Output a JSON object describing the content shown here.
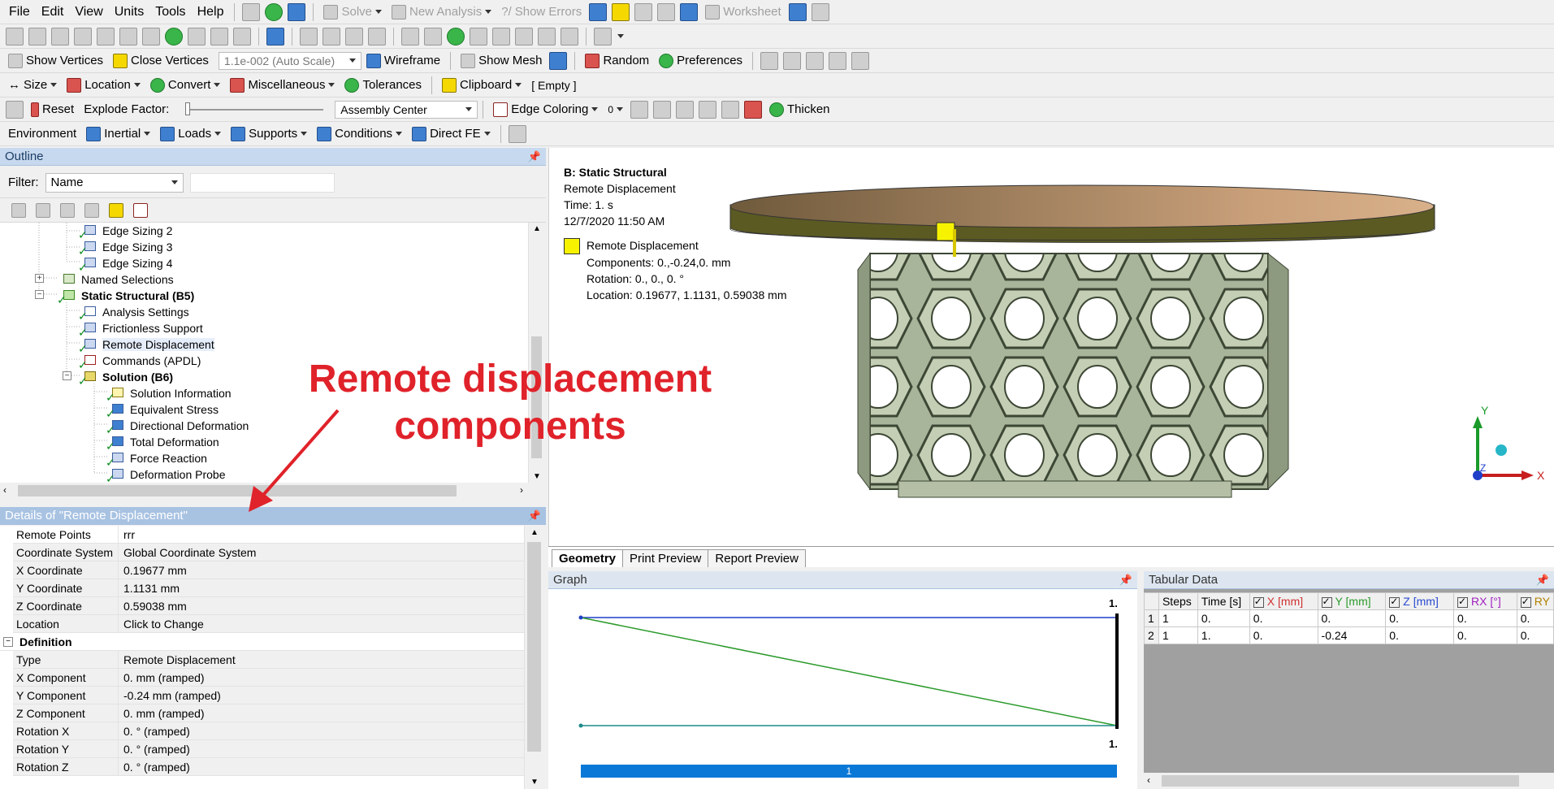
{
  "menubar": {
    "items": [
      "File",
      "Edit",
      "View",
      "Units",
      "Tools",
      "Help"
    ],
    "solve_label": "Solve",
    "new_analysis_label": "New Analysis",
    "show_errors_label": "Show Errors",
    "worksheet_label": "Worksheet"
  },
  "toolbar3": {
    "show_vertices": "Show Vertices",
    "close_vertices": "Close Vertices",
    "scale_value": "1.1e-002 (Auto Scale)",
    "wireframe": "Wireframe",
    "show_mesh": "Show Mesh",
    "random": "Random",
    "preferences": "Preferences"
  },
  "toolbar4": {
    "size": "Size",
    "location": "Location",
    "convert": "Convert",
    "miscellaneous": "Miscellaneous",
    "tolerances": "Tolerances",
    "clipboard": "Clipboard",
    "clipboard_state": "[ Empty ]"
  },
  "toolbar5": {
    "reset": "Reset",
    "explode_factor": "Explode Factor:",
    "assembly_center": "Assembly Center",
    "edge_coloring": "Edge Coloring",
    "zero": "0",
    "thicken": "Thicken"
  },
  "toolbar6": {
    "environment": "Environment",
    "inertial": "Inertial",
    "loads": "Loads",
    "supports": "Supports",
    "conditions": "Conditions",
    "direct_fe": "Direct FE"
  },
  "outline": {
    "title": "Outline",
    "filter_label": "Filter:",
    "filter_value": "Name",
    "tree": [
      {
        "label": "Edge Sizing 2",
        "bold": false
      },
      {
        "label": "Edge Sizing 3",
        "bold": false
      },
      {
        "label": "Edge Sizing 4",
        "bold": false
      },
      {
        "label": "Named Selections",
        "bold": false
      },
      {
        "label": "Static Structural (B5)",
        "bold": true
      },
      {
        "label": "Analysis Settings",
        "bold": false
      },
      {
        "label": "Frictionless Support",
        "bold": false
      },
      {
        "label": "Remote Displacement",
        "bold": false
      },
      {
        "label": "Commands (APDL)",
        "bold": false
      },
      {
        "label": "Solution (B6)",
        "bold": true
      },
      {
        "label": "Solution Information",
        "bold": false
      },
      {
        "label": "Equivalent Stress",
        "bold": false
      },
      {
        "label": "Directional Deformation",
        "bold": false
      },
      {
        "label": "Total Deformation",
        "bold": false
      },
      {
        "label": "Force Reaction",
        "bold": false
      },
      {
        "label": "Deformation Probe",
        "bold": false
      }
    ]
  },
  "details": {
    "title": "Details of \"Remote Displacement\"",
    "rows": [
      {
        "k": "Remote Points",
        "v": "rrr"
      },
      {
        "k": "Coordinate System",
        "v": "Global Coordinate System"
      },
      {
        "k": "X Coordinate",
        "v": "0.19677 mm"
      },
      {
        "k": "Y Coordinate",
        "v": "1.1131 mm"
      },
      {
        "k": "Z Coordinate",
        "v": "0.59038 mm"
      },
      {
        "k": "Location",
        "v": "Click to Change"
      }
    ],
    "group": "Definition",
    "def_rows": [
      {
        "k": "Type",
        "v": "Remote Displacement"
      },
      {
        "k": "X Component",
        "v": "0. mm  (ramped)"
      },
      {
        "k": "Y Component",
        "v": "-0.24 mm  (ramped)"
      },
      {
        "k": "Z Component",
        "v": "0. mm  (ramped)"
      },
      {
        "k": "Rotation X",
        "v": "0. °  (ramped)"
      },
      {
        "k": "Rotation Y",
        "v": "0. °  (ramped)"
      },
      {
        "k": "Rotation Z",
        "v": "0. °  (ramped)"
      }
    ]
  },
  "viewport": {
    "title": "B: Static Structural",
    "subtitle": "Remote Displacement",
    "time": "Time: 1. s",
    "date": "12/7/2020 11:50 AM",
    "legend_name": "Remote Displacement",
    "legend_components": "Components: 0.,-0.24,0. mm",
    "legend_rotation": "Rotation: 0., 0., 0. °",
    "legend_location": "Location: 0.19677, 1.1131, 0.59038 mm",
    "axis_x": "X",
    "axis_y": "Y",
    "axis_z": "Z"
  },
  "tabs": [
    "Geometry",
    "Print Preview",
    "Report Preview"
  ],
  "graph": {
    "title": "Graph",
    "top_label": "1.",
    "bottom_label": "1.",
    "step_label": "1"
  },
  "tabular": {
    "title": "Tabular Data",
    "headers": [
      "Steps",
      "Time [s]",
      "X [mm]",
      "Y [mm]",
      "Z [mm]",
      "RX [°]",
      "RY"
    ],
    "rows": [
      [
        "1",
        "1",
        "0.",
        "0.",
        "0.",
        "0.",
        "0.",
        "0."
      ],
      [
        "2",
        "1",
        "1.",
        "0.",
        "-0.24",
        "0.",
        "0.",
        "0."
      ]
    ]
  },
  "annotation": {
    "line1": "Remote displacement",
    "line2": "components"
  },
  "colors": {
    "annotation": "#e0222a",
    "legend_swatch": "#f7f300",
    "graph_blue": "#1f3fc8",
    "graph_green": "#2a9a2a",
    "plate": "#b8916c",
    "lattice": "#b9c4ac",
    "progress": "#0a78d7"
  }
}
